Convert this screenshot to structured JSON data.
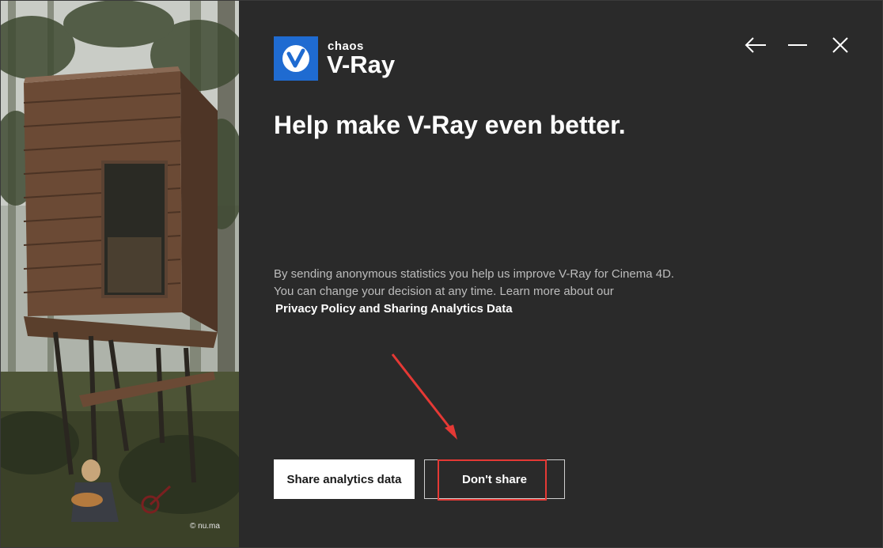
{
  "hero": {
    "credit": "© nu.ma"
  },
  "brand": {
    "company": "chaos",
    "product": "V-Ray",
    "logo_icon": "vray-logo-icon",
    "accent": "#1f6bd1"
  },
  "window_controls": {
    "back_icon": "arrow-left-icon",
    "minimize_icon": "minimize-icon",
    "close_icon": "close-icon"
  },
  "main": {
    "headline": "Help make V-Ray even better.",
    "description_line1": "By sending anonymous statistics you help us improve V-Ray for Cinema 4D.",
    "description_line2": "You can change your decision at any time. Learn more about our",
    "policy_link": "Privacy Policy and Sharing Analytics Data"
  },
  "buttons": {
    "share": "Share analytics data",
    "dont_share": "Don't share"
  },
  "annotation": {
    "color": "#e53935",
    "target": "dont-share-button"
  }
}
